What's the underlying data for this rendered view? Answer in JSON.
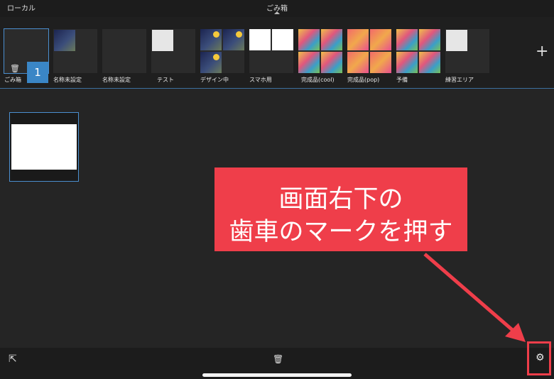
{
  "header": {
    "left_label": "ローカル",
    "title": "ごみ箱"
  },
  "shelf": {
    "folders": [
      {
        "label": "ごみ箱",
        "count": "1"
      },
      {
        "label": "名称未設定"
      },
      {
        "label": "名称未設定"
      },
      {
        "label": "テスト"
      },
      {
        "label": "デザイン中"
      },
      {
        "label": "スマホ用"
      },
      {
        "label": "完成品(cool)"
      },
      {
        "label": "完成品(pop)"
      },
      {
        "label": "予備"
      },
      {
        "label": "練習エリア"
      }
    ],
    "add_icon": "plus-icon"
  },
  "annotation": {
    "line1": "画面右下の",
    "line2": "歯車のマークを押す",
    "color": "#ef3e4a"
  },
  "toolbar": {
    "export_icon": "export-icon",
    "trash_icon": "trash-icon",
    "settings_icon": "gear-icon"
  },
  "colors": {
    "accent": "#3a86c6",
    "background": "#252525"
  }
}
